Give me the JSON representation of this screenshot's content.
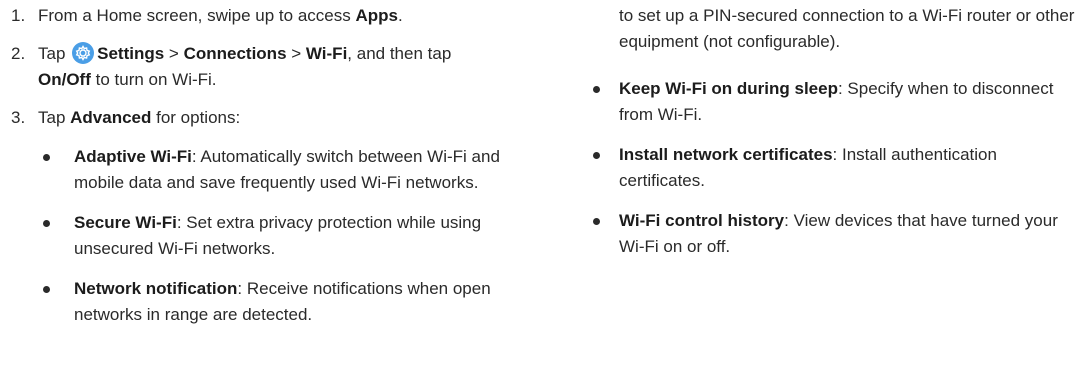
{
  "steps": [
    {
      "num": "1.",
      "t1": "From a Home screen, swipe up to access ",
      "b1": "Apps",
      "t2": "."
    },
    {
      "num": "2.",
      "t1": "Tap ",
      "b_settings": "Settings",
      "sep1": " > ",
      "b_connections": "Connections",
      "sep2": " > ",
      "b_wifi": "Wi-Fi",
      "t2": ", and then tap ",
      "b_onoff": "On/Off",
      "t3": " to turn on Wi-Fi."
    },
    {
      "num": "3.",
      "t1": "Tap ",
      "b1": "Advanced",
      "t2": " for options:"
    }
  ],
  "options_left": [
    {
      "term": "Adaptive Wi-Fi",
      "desc": ": Automatically switch between Wi-Fi and mobile data and save frequently used Wi-Fi networks."
    },
    {
      "term": "Secure Wi-Fi",
      "desc": ": Set extra privacy protection while using unsecured Wi-Fi networks."
    },
    {
      "term": "Network notification",
      "desc": ": Receive notifications when open networks in range are detected."
    }
  ],
  "continuation": "to set up a PIN-secured connection to a Wi-Fi router or other equipment (not configurable).",
  "options_right": [
    {
      "term": "Keep Wi-Fi on during sleep",
      "desc": ": Specify when to disconnect from Wi-Fi."
    },
    {
      "term": "Install network certificates",
      "desc": ": Install authentication certificates."
    },
    {
      "term": "Wi-Fi control history",
      "desc": ": View devices that have turned your Wi-Fi on or off."
    }
  ],
  "icons": {
    "settings": "settings-gear-icon"
  },
  "colors": {
    "settings_icon": "#4a9ee6",
    "text": "#2a2a2a"
  }
}
